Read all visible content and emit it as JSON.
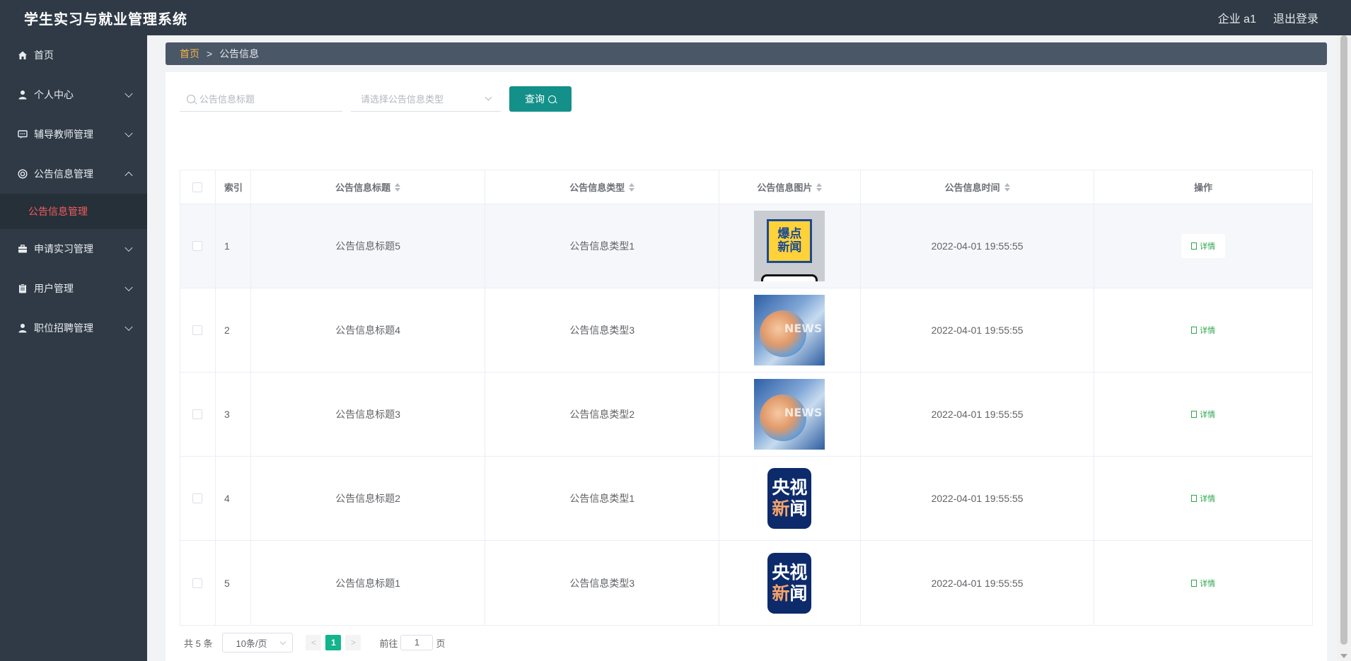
{
  "header": {
    "title": "学生实习与就业管理系统",
    "user": "企业 a1",
    "logout": "退出登录"
  },
  "sidebar": {
    "items": [
      {
        "label": "首页",
        "icon": "home-icon"
      },
      {
        "label": "个人中心",
        "icon": "user-icon"
      },
      {
        "label": "辅导教师管理",
        "icon": "chat-icon"
      },
      {
        "label": "公告信息管理",
        "icon": "bulletin-icon"
      },
      {
        "label": "申请实习管理",
        "icon": "briefcase-icon"
      },
      {
        "label": "用户管理",
        "icon": "clipboard-icon"
      },
      {
        "label": "职位招聘管理",
        "icon": "user-icon"
      }
    ],
    "sub_item": "公告信息管理",
    "accent_color": "#f25d5d"
  },
  "breadcrumb": {
    "home": "首页",
    "separator": ">",
    "current": "公告信息"
  },
  "search": {
    "title_placeholder": "公告信息标题",
    "type_placeholder": "请选择公告信息类型",
    "query_label": "查询"
  },
  "table": {
    "columns": [
      "索引",
      "公告信息标题",
      "公告信息类型",
      "公告信息图片",
      "公告信息时间",
      "操作"
    ],
    "rows": [
      {
        "index": "1",
        "title": "公告信息标题5",
        "type": "公告信息类型1",
        "image": "爆点新闻",
        "time": "2022-04-01 19:55:55",
        "action": "详情"
      },
      {
        "index": "2",
        "title": "公告信息标题4",
        "type": "公告信息类型3",
        "image": "NEWS",
        "time": "2022-04-01 19:55:55",
        "action": "详情"
      },
      {
        "index": "3",
        "title": "公告信息标题3",
        "type": "公告信息类型2",
        "image": "NEWS",
        "time": "2022-04-01 19:55:55",
        "action": "详情"
      },
      {
        "index": "4",
        "title": "公告信息标题2",
        "type": "公告信息类型1",
        "image": "央视新闻",
        "time": "2022-04-01 19:55:55",
        "action": "详情"
      },
      {
        "index": "5",
        "title": "公告信息标题1",
        "type": "公告信息类型3",
        "image": "央视新闻",
        "time": "2022-04-01 19:55:55",
        "action": "详情"
      }
    ]
  },
  "thumbs": {
    "bao_line1": "爆点",
    "bao_line2": "新闻",
    "news_text": "NEWS",
    "cctv_line1": "央视",
    "cctv_line2_a": "新",
    "cctv_line2_b": "闻"
  },
  "pagination": {
    "total": "共 5 条",
    "page_size": "10条/页",
    "prev": "<",
    "current_page": "1",
    "next": ">",
    "goto_label": "前往",
    "goto_value": "1",
    "page_suffix": "页"
  },
  "colors": {
    "primary": "#14908a",
    "header_bg": "#2f3a46",
    "breadcrumb_home": "#f6b34a",
    "detail": "#2aa54c"
  }
}
